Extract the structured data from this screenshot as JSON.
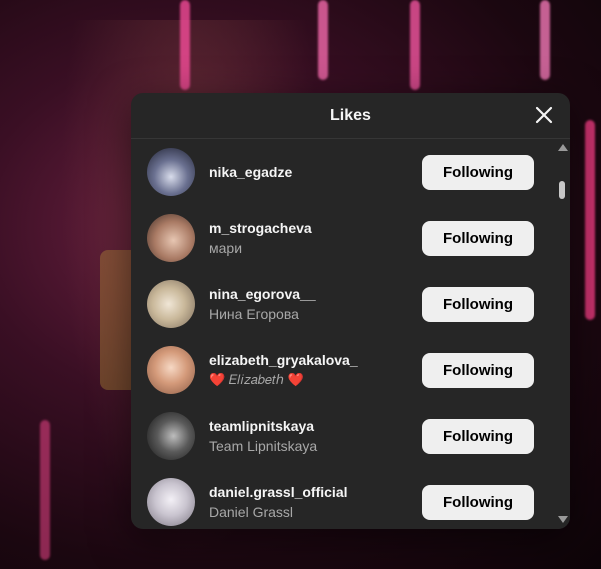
{
  "dialog": {
    "title": "Likes",
    "close_icon": "close-icon"
  },
  "likes": [
    {
      "username": "nika_egadze",
      "fullname": "",
      "button": "Following",
      "avatar_color": "#4a4f6a"
    },
    {
      "username": "m_strogacheva",
      "fullname": "мари",
      "button": "Following",
      "avatar_color": "#a97a64"
    },
    {
      "username": "nina_egorova__",
      "fullname": "Нина Егорова",
      "button": "Following",
      "avatar_color": "#c9b89a"
    },
    {
      "username": "elizabeth_gryakalova_",
      "fullname": "❤️ 𝐸𝑙𝑖𝑧𝑎𝑏𝑒𝑡ℎ ❤️",
      "button": "Following",
      "avatar_color": "#d49a7a"
    },
    {
      "username": "teamlipnitskaya",
      "fullname": "Team Lipnitskaya",
      "button": "Following",
      "avatar_color": "#5a5a5a"
    },
    {
      "username": "daniel.grassl_official",
      "fullname": "Daniel Grassl",
      "button": "Following",
      "avatar_color": "#c9c4cf"
    }
  ]
}
